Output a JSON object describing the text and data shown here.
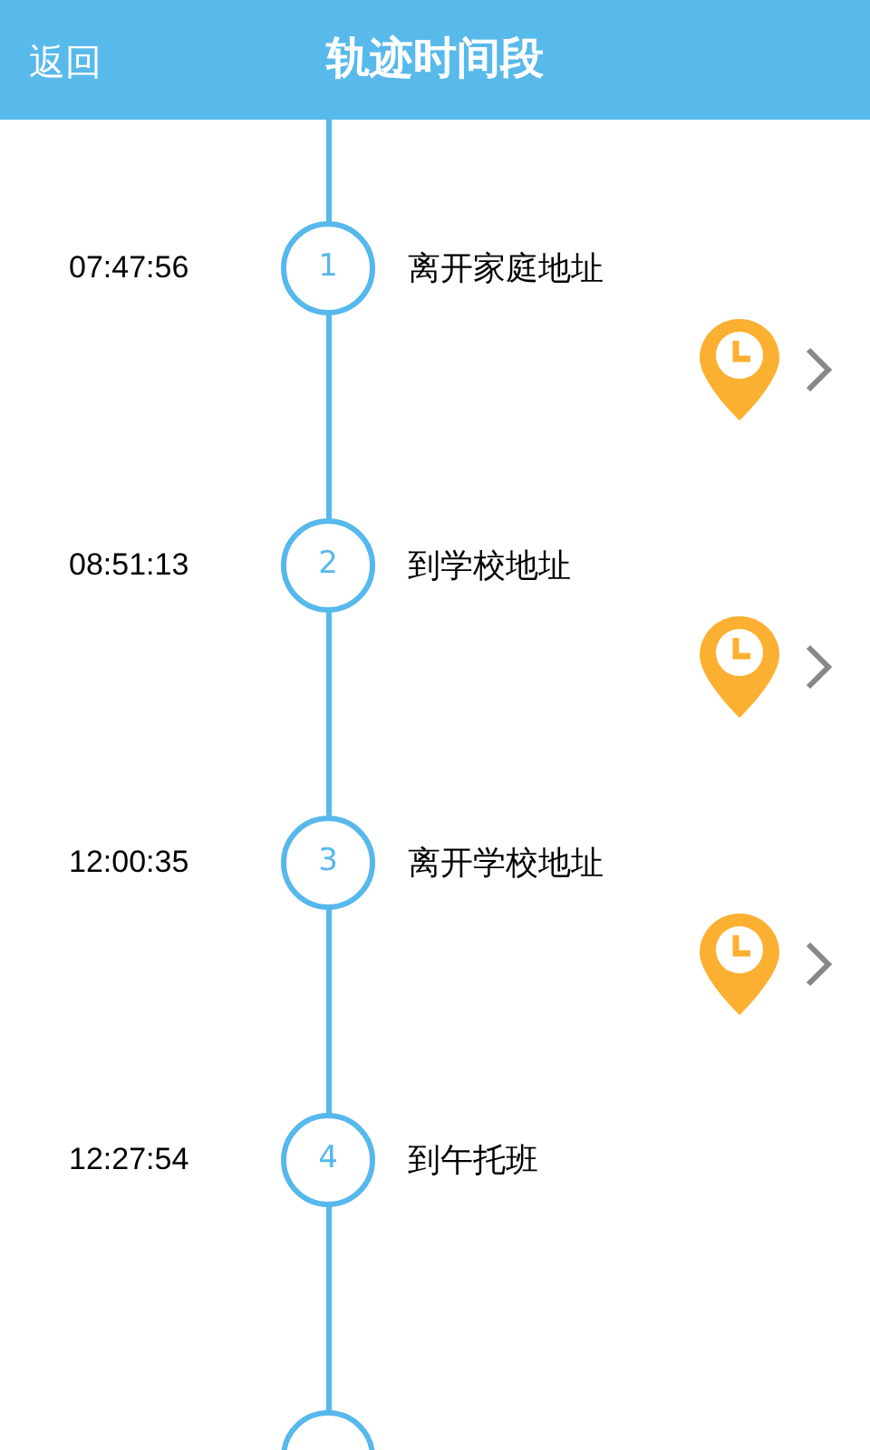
{
  "header": {
    "back": "返回",
    "title": "轨迹时间段"
  },
  "items": [
    {
      "number": "1",
      "time": "07:47:56",
      "label": "离开家庭地址",
      "has_location": true
    },
    {
      "number": "2",
      "time": "08:51:13",
      "label": "到学校地址",
      "has_location": true
    },
    {
      "number": "3",
      "time": "12:00:35",
      "label": "离开学校地址",
      "has_location": true
    },
    {
      "number": "4",
      "time": "12:27:54",
      "label": "到午托班",
      "has_location": false
    }
  ],
  "trailing_marker": true
}
